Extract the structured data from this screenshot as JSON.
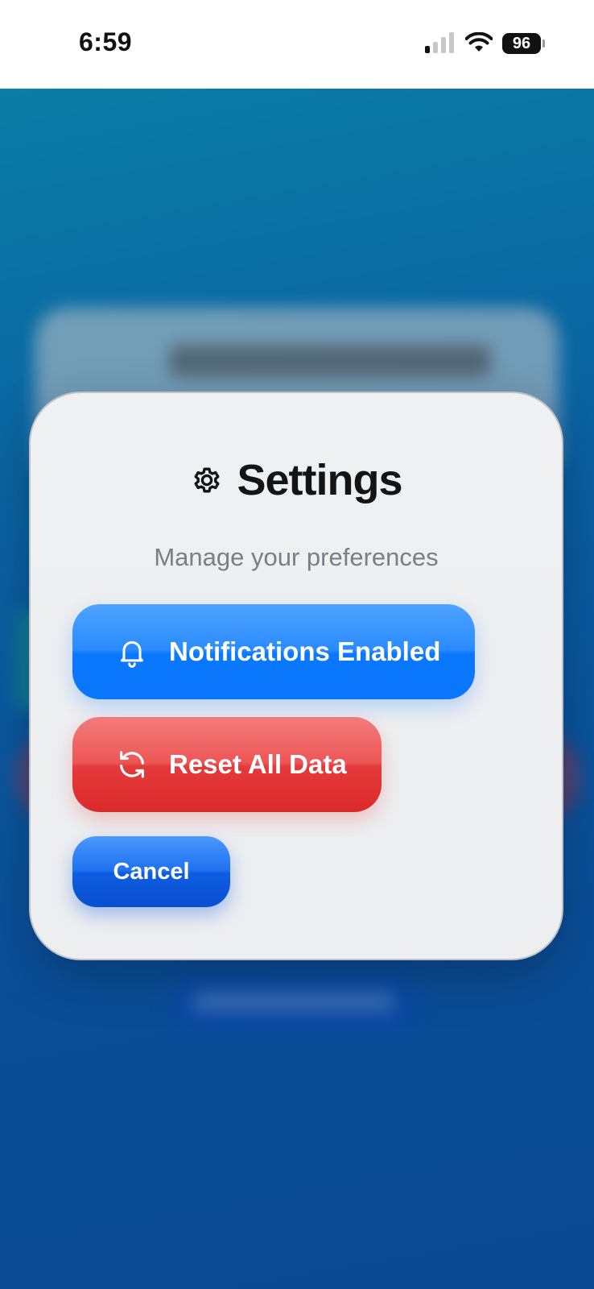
{
  "status_bar": {
    "time": "6:59",
    "battery": "96"
  },
  "modal": {
    "title": "Settings",
    "subtitle": "Manage your preferences",
    "buttons": {
      "notifications": "Notifications Enabled",
      "reset": "Reset All Data",
      "cancel": "Cancel"
    }
  },
  "icons": {
    "header": "gear-icon",
    "notifications": "bell-icon",
    "reset": "refresh-icon"
  },
  "colors": {
    "primary_blue": "#0A78FF",
    "danger_red": "#E43A3B",
    "cancel_blue": "#0E5DE0",
    "backdrop_blue": "#0A5AA0"
  }
}
